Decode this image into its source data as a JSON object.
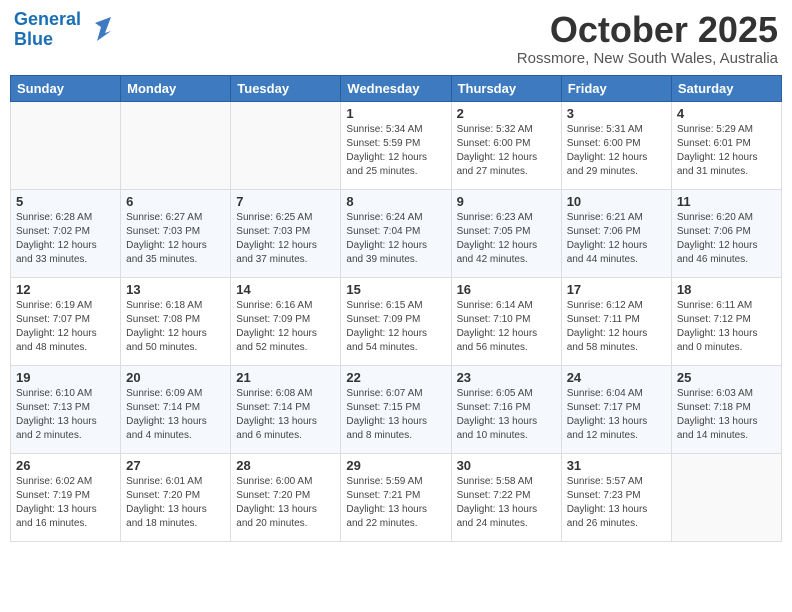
{
  "logo": {
    "line1": "General",
    "line2": "Blue"
  },
  "title": "October 2025",
  "subtitle": "Rossmore, New South Wales, Australia",
  "weekdays": [
    "Sunday",
    "Monday",
    "Tuesday",
    "Wednesday",
    "Thursday",
    "Friday",
    "Saturday"
  ],
  "weeks": [
    [
      {
        "day": "",
        "info": ""
      },
      {
        "day": "",
        "info": ""
      },
      {
        "day": "",
        "info": ""
      },
      {
        "day": "1",
        "info": "Sunrise: 5:34 AM\nSunset: 5:59 PM\nDaylight: 12 hours\nand 25 minutes."
      },
      {
        "day": "2",
        "info": "Sunrise: 5:32 AM\nSunset: 6:00 PM\nDaylight: 12 hours\nand 27 minutes."
      },
      {
        "day": "3",
        "info": "Sunrise: 5:31 AM\nSunset: 6:00 PM\nDaylight: 12 hours\nand 29 minutes."
      },
      {
        "day": "4",
        "info": "Sunrise: 5:29 AM\nSunset: 6:01 PM\nDaylight: 12 hours\nand 31 minutes."
      }
    ],
    [
      {
        "day": "5",
        "info": "Sunrise: 6:28 AM\nSunset: 7:02 PM\nDaylight: 12 hours\nand 33 minutes."
      },
      {
        "day": "6",
        "info": "Sunrise: 6:27 AM\nSunset: 7:03 PM\nDaylight: 12 hours\nand 35 minutes."
      },
      {
        "day": "7",
        "info": "Sunrise: 6:25 AM\nSunset: 7:03 PM\nDaylight: 12 hours\nand 37 minutes."
      },
      {
        "day": "8",
        "info": "Sunrise: 6:24 AM\nSunset: 7:04 PM\nDaylight: 12 hours\nand 39 minutes."
      },
      {
        "day": "9",
        "info": "Sunrise: 6:23 AM\nSunset: 7:05 PM\nDaylight: 12 hours\nand 42 minutes."
      },
      {
        "day": "10",
        "info": "Sunrise: 6:21 AM\nSunset: 7:06 PM\nDaylight: 12 hours\nand 44 minutes."
      },
      {
        "day": "11",
        "info": "Sunrise: 6:20 AM\nSunset: 7:06 PM\nDaylight: 12 hours\nand 46 minutes."
      }
    ],
    [
      {
        "day": "12",
        "info": "Sunrise: 6:19 AM\nSunset: 7:07 PM\nDaylight: 12 hours\nand 48 minutes."
      },
      {
        "day": "13",
        "info": "Sunrise: 6:18 AM\nSunset: 7:08 PM\nDaylight: 12 hours\nand 50 minutes."
      },
      {
        "day": "14",
        "info": "Sunrise: 6:16 AM\nSunset: 7:09 PM\nDaylight: 12 hours\nand 52 minutes."
      },
      {
        "day": "15",
        "info": "Sunrise: 6:15 AM\nSunset: 7:09 PM\nDaylight: 12 hours\nand 54 minutes."
      },
      {
        "day": "16",
        "info": "Sunrise: 6:14 AM\nSunset: 7:10 PM\nDaylight: 12 hours\nand 56 minutes."
      },
      {
        "day": "17",
        "info": "Sunrise: 6:12 AM\nSunset: 7:11 PM\nDaylight: 12 hours\nand 58 minutes."
      },
      {
        "day": "18",
        "info": "Sunrise: 6:11 AM\nSunset: 7:12 PM\nDaylight: 13 hours\nand 0 minutes."
      }
    ],
    [
      {
        "day": "19",
        "info": "Sunrise: 6:10 AM\nSunset: 7:13 PM\nDaylight: 13 hours\nand 2 minutes."
      },
      {
        "day": "20",
        "info": "Sunrise: 6:09 AM\nSunset: 7:14 PM\nDaylight: 13 hours\nand 4 minutes."
      },
      {
        "day": "21",
        "info": "Sunrise: 6:08 AM\nSunset: 7:14 PM\nDaylight: 13 hours\nand 6 minutes."
      },
      {
        "day": "22",
        "info": "Sunrise: 6:07 AM\nSunset: 7:15 PM\nDaylight: 13 hours\nand 8 minutes."
      },
      {
        "day": "23",
        "info": "Sunrise: 6:05 AM\nSunset: 7:16 PM\nDaylight: 13 hours\nand 10 minutes."
      },
      {
        "day": "24",
        "info": "Sunrise: 6:04 AM\nSunset: 7:17 PM\nDaylight: 13 hours\nand 12 minutes."
      },
      {
        "day": "25",
        "info": "Sunrise: 6:03 AM\nSunset: 7:18 PM\nDaylight: 13 hours\nand 14 minutes."
      }
    ],
    [
      {
        "day": "26",
        "info": "Sunrise: 6:02 AM\nSunset: 7:19 PM\nDaylight: 13 hours\nand 16 minutes."
      },
      {
        "day": "27",
        "info": "Sunrise: 6:01 AM\nSunset: 7:20 PM\nDaylight: 13 hours\nand 18 minutes."
      },
      {
        "day": "28",
        "info": "Sunrise: 6:00 AM\nSunset: 7:20 PM\nDaylight: 13 hours\nand 20 minutes."
      },
      {
        "day": "29",
        "info": "Sunrise: 5:59 AM\nSunset: 7:21 PM\nDaylight: 13 hours\nand 22 minutes."
      },
      {
        "day": "30",
        "info": "Sunrise: 5:58 AM\nSunset: 7:22 PM\nDaylight: 13 hours\nand 24 minutes."
      },
      {
        "day": "31",
        "info": "Sunrise: 5:57 AM\nSunset: 7:23 PM\nDaylight: 13 hours\nand 26 minutes."
      },
      {
        "day": "",
        "info": ""
      }
    ]
  ]
}
